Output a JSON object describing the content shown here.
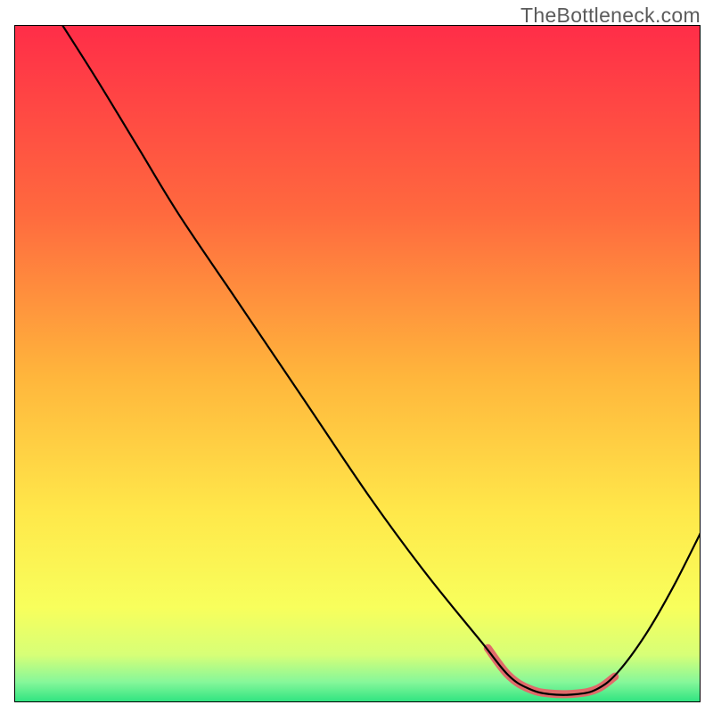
{
  "watermark": "TheBottleneck.com",
  "chart_data": {
    "type": "line",
    "title": "",
    "xlabel": "",
    "ylabel": "",
    "xlim": [
      0,
      100
    ],
    "ylim": [
      0,
      100
    ],
    "gradient": {
      "stops": [
        {
          "offset": 0.0,
          "color": "#ff2d48"
        },
        {
          "offset": 0.28,
          "color": "#ff6a3e"
        },
        {
          "offset": 0.52,
          "color": "#ffb63c"
        },
        {
          "offset": 0.72,
          "color": "#ffe84a"
        },
        {
          "offset": 0.86,
          "color": "#f8ff5c"
        },
        {
          "offset": 0.93,
          "color": "#d7ff77"
        },
        {
          "offset": 0.97,
          "color": "#86f79a"
        },
        {
          "offset": 1.0,
          "color": "#2de380"
        }
      ]
    },
    "series": [
      {
        "name": "bottleneck-curve",
        "color": "#000000",
        "width": 2.2,
        "points": [
          {
            "x": 7.0,
            "y": 100.0
          },
          {
            "x": 12.0,
            "y": 92.0
          },
          {
            "x": 18.0,
            "y": 82.0
          },
          {
            "x": 24.0,
            "y": 72.0
          },
          {
            "x": 32.0,
            "y": 60.0
          },
          {
            "x": 42.0,
            "y": 45.0
          },
          {
            "x": 52.0,
            "y": 30.0
          },
          {
            "x": 60.0,
            "y": 19.0
          },
          {
            "x": 68.0,
            "y": 9.0
          },
          {
            "x": 72.0,
            "y": 4.0
          },
          {
            "x": 75.0,
            "y": 2.0
          },
          {
            "x": 78.0,
            "y": 1.2
          },
          {
            "x": 82.0,
            "y": 1.2
          },
          {
            "x": 85.0,
            "y": 2.0
          },
          {
            "x": 88.0,
            "y": 4.5
          },
          {
            "x": 92.0,
            "y": 10.0
          },
          {
            "x": 96.0,
            "y": 17.0
          },
          {
            "x": 100.0,
            "y": 25.0
          }
        ]
      },
      {
        "name": "valley-highlight",
        "color": "#e06a6a",
        "width": 9.0,
        "points": [
          {
            "x": 69.0,
            "y": 8.0
          },
          {
            "x": 72.0,
            "y": 4.0
          },
          {
            "x": 75.0,
            "y": 2.0
          },
          {
            "x": 78.0,
            "y": 1.3
          },
          {
            "x": 82.0,
            "y": 1.3
          },
          {
            "x": 85.0,
            "y": 2.0
          },
          {
            "x": 87.5,
            "y": 3.8
          }
        ]
      }
    ]
  }
}
